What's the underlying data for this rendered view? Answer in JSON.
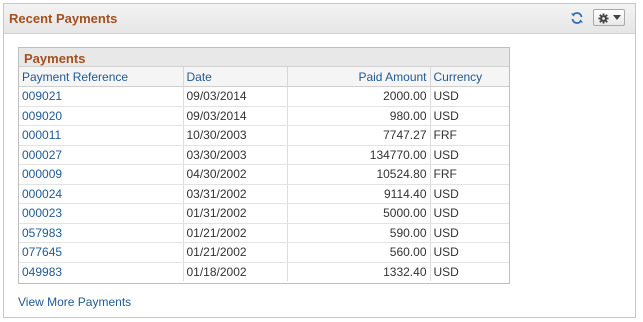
{
  "panel": {
    "title": "Recent Payments"
  },
  "grid": {
    "title": "Payments",
    "columns": [
      "Payment Reference",
      "Date",
      "Paid Amount",
      "Currency"
    ],
    "rows": [
      [
        "009021",
        "09/03/2014",
        "2000.00",
        "USD"
      ],
      [
        "009020",
        "09/03/2014",
        "980.00",
        "USD"
      ],
      [
        "000011",
        "10/30/2003",
        "7747.27",
        "FRF"
      ],
      [
        "000027",
        "03/30/2003",
        "134770.00",
        "USD"
      ],
      [
        "000009",
        "04/30/2002",
        "10524.80",
        "FRF"
      ],
      [
        "000024",
        "03/31/2002",
        "9114.40",
        "USD"
      ],
      [
        "000023",
        "01/31/2002",
        "5000.00",
        "USD"
      ],
      [
        "057983",
        "01/21/2002",
        "590.00",
        "USD"
      ],
      [
        "077645",
        "01/21/2002",
        "560.00",
        "USD"
      ],
      [
        "049983",
        "01/18/2002",
        "1332.40",
        "USD"
      ]
    ]
  },
  "footer": {
    "more_link": "View More Payments"
  },
  "icons": {
    "refresh": "refresh-icon",
    "settings": "gear-icon",
    "dropdown": "chevron-down-icon"
  },
  "colors": {
    "title": "#a4501f",
    "link": "#215a94"
  }
}
